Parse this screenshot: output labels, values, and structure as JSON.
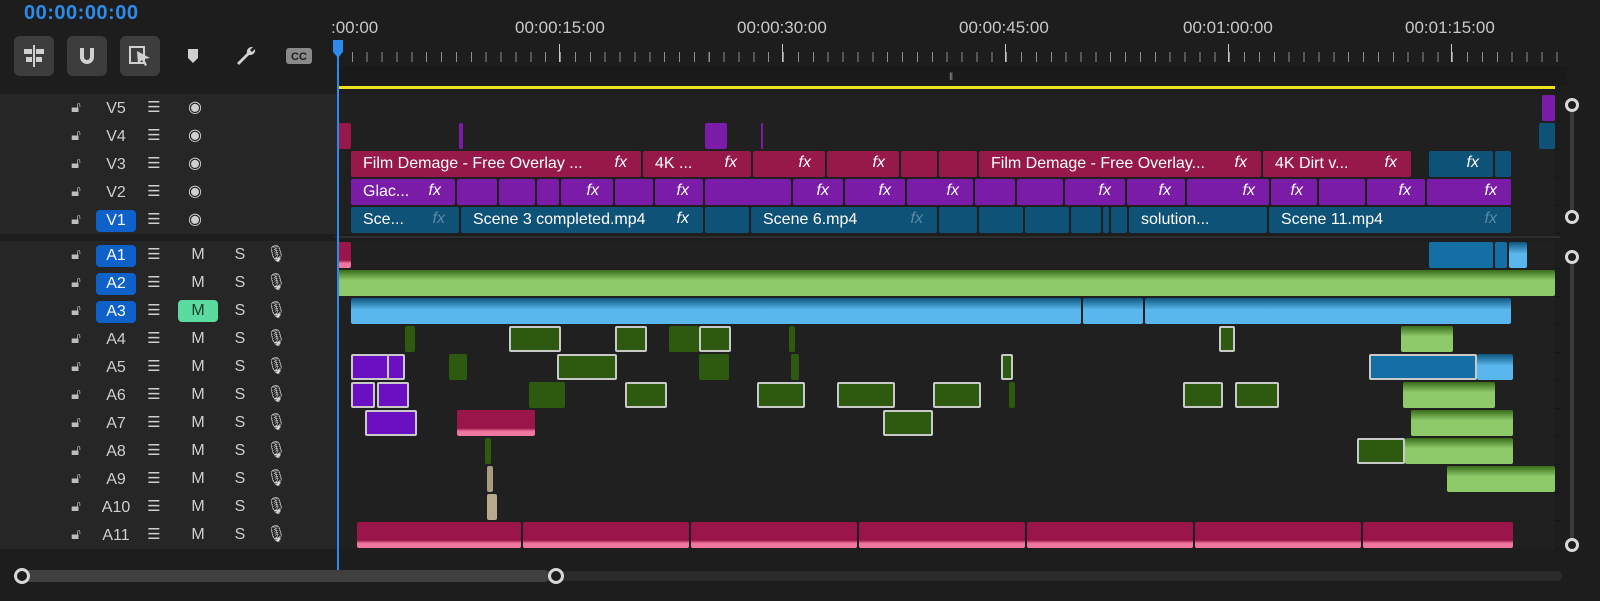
{
  "timecode": "00:00:00:00",
  "ruler": {
    "labels": [
      ":00:00",
      "00:00:15:00",
      "00:00:30:00",
      "00:00:45:00",
      "00:01:00:00",
      "00:01:15:00"
    ]
  },
  "toolbar": {
    "icons": [
      "insert-overwrite-icon",
      "snap-icon",
      "linked-selection-icon",
      "add-marker-icon",
      "timeline-settings-icon",
      "captions-icon"
    ]
  },
  "tracks": {
    "video": [
      {
        "name": "V5",
        "clips": [
          {
            "name": "",
            "fx": "",
            "color": "v-pur"
          }
        ]
      },
      {
        "name": "V4",
        "clips": []
      },
      {
        "name": "V3",
        "clips": [
          {
            "name": "Film Demage - Free Overlay ...",
            "fx": "fx"
          },
          {
            "name": "4K ...",
            "fx": "fx"
          },
          {
            "name": "",
            "fx": "fx"
          },
          {
            "name": "",
            "fx": "fx"
          },
          {
            "name": "Film Demage - Free Overlay...",
            "fx": "fx"
          },
          {
            "name": "4K Dirt v...",
            "fx": "fx"
          },
          {
            "name": "",
            "fx": "fx"
          }
        ]
      },
      {
        "name": "V2",
        "clips": [
          {
            "name": "Glac...",
            "fx": "fx"
          },
          {
            "name": "",
            "fx": "fx"
          },
          {
            "name": "",
            "fx": "fx"
          },
          {
            "name": "",
            "fx": "fx"
          },
          {
            "name": "",
            "fx": "fx"
          },
          {
            "name": "",
            "fx": "fx"
          },
          {
            "name": "",
            "fx": "fx"
          },
          {
            "name": "",
            "fx": "fx"
          },
          {
            "name": "",
            "fx": "fx"
          },
          {
            "name": "",
            "fx": "fx"
          },
          {
            "name": "",
            "fx": "fx"
          },
          {
            "name": "",
            "fx": "fx"
          }
        ]
      },
      {
        "name": "V1",
        "selected": true,
        "clips": [
          {
            "name": "Sce...",
            "fx": "fx"
          },
          {
            "name": "Scene 3 completed.mp4",
            "fx": "fx"
          },
          {
            "name": "Scene 6.mp4",
            "fx": "fx"
          },
          {
            "name": "solution...",
            "fx": ""
          },
          {
            "name": "Scene 11.mp4",
            "fx": "fx"
          }
        ]
      }
    ],
    "audio": [
      {
        "name": "A1",
        "selected": true,
        "mute": "M",
        "solo": "S",
        "mute_on": false
      },
      {
        "name": "A2",
        "selected": true,
        "mute": "M",
        "solo": "S",
        "mute_on": false
      },
      {
        "name": "A3",
        "selected": true,
        "mute": "M",
        "solo": "S",
        "mute_on": true
      },
      {
        "name": "A4",
        "selected": false,
        "mute": "M",
        "solo": "S",
        "mute_on": false
      },
      {
        "name": "A5",
        "selected": false,
        "mute": "M",
        "solo": "S",
        "mute_on": false
      },
      {
        "name": "A6",
        "selected": false,
        "mute": "M",
        "solo": "S",
        "mute_on": false
      },
      {
        "name": "A7",
        "selected": false,
        "mute": "M",
        "solo": "S",
        "mute_on": false
      },
      {
        "name": "A8",
        "selected": false,
        "mute": "M",
        "solo": "S",
        "mute_on": false
      },
      {
        "name": "A9",
        "selected": false,
        "mute": "M",
        "solo": "S",
        "mute_on": false
      },
      {
        "name": "A10",
        "selected": false,
        "mute": "M",
        "solo": "S",
        "mute_on": false
      },
      {
        "name": "A11",
        "selected": false,
        "mute": "M",
        "solo": "S",
        "mute_on": false
      }
    ]
  },
  "colors": {
    "accent": "#2d8ceb",
    "work_area": "#ece11e",
    "mute_on": "#5bdba0",
    "video_red": "#96194a",
    "video_purple": "#7b1ca8",
    "video_blue": "#0e5277",
    "audio_green": "#8ec96a",
    "audio_cyan": "#5ab7ee",
    "audio_pink": "#f0779f"
  }
}
